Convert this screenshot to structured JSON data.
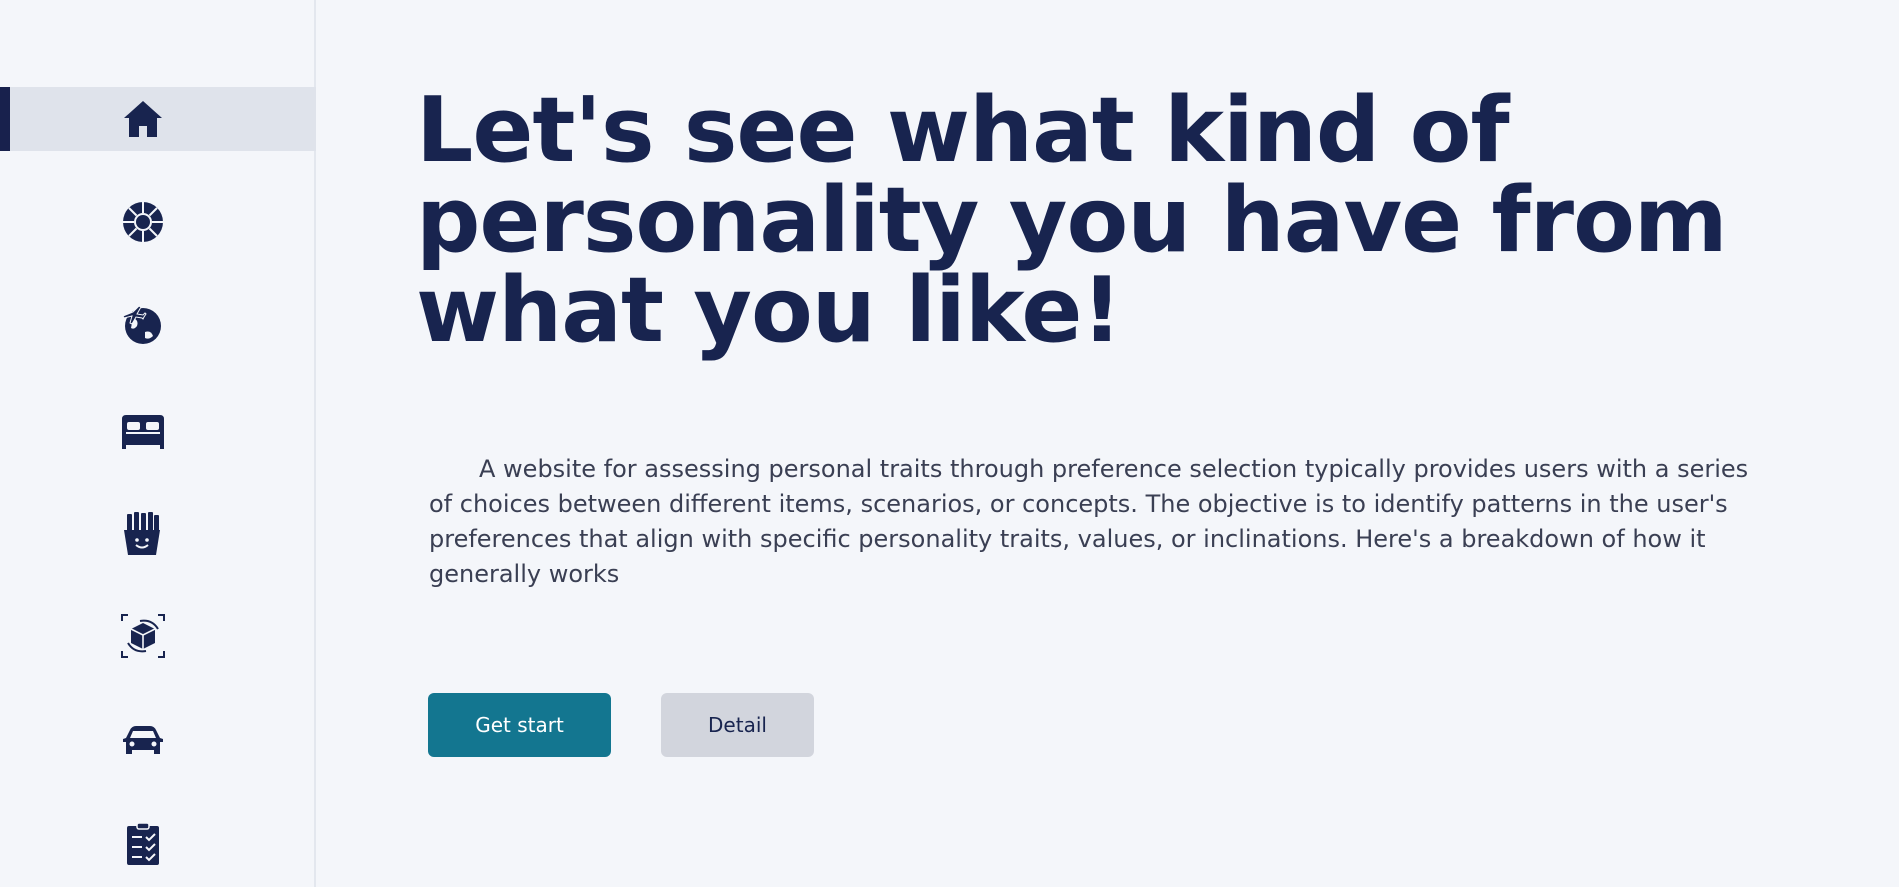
{
  "colors": {
    "background": "#f4f6fa",
    "navy": "#18244f",
    "primary_button": "#137690",
    "secondary_button": "#d2d5dd",
    "active_nav": "#dfe3eb"
  },
  "sidebar": {
    "items": [
      {
        "icon": "home-icon",
        "active": true
      },
      {
        "icon": "sports-ball-icon",
        "active": false
      },
      {
        "icon": "travel-globe-icon",
        "active": false
      },
      {
        "icon": "bed-icon",
        "active": false
      },
      {
        "icon": "fries-food-icon",
        "active": false
      },
      {
        "icon": "ar-cube-icon",
        "active": false
      },
      {
        "icon": "car-icon",
        "active": false
      },
      {
        "icon": "checklist-clipboard-icon",
        "active": false
      }
    ]
  },
  "hero": {
    "title": "Let's see what kind of personality you have from what you like!",
    "description": "A website for assessing personal traits through preference selection typically provides users with a series of choices between different items, scenarios, or concepts. The objective is to identify patterns in the user's preferences that align with specific personality traits, values, or inclinations. Here's a breakdown of how it generally works"
  },
  "buttons": {
    "get_start": "Get start",
    "detail": "Detail"
  }
}
